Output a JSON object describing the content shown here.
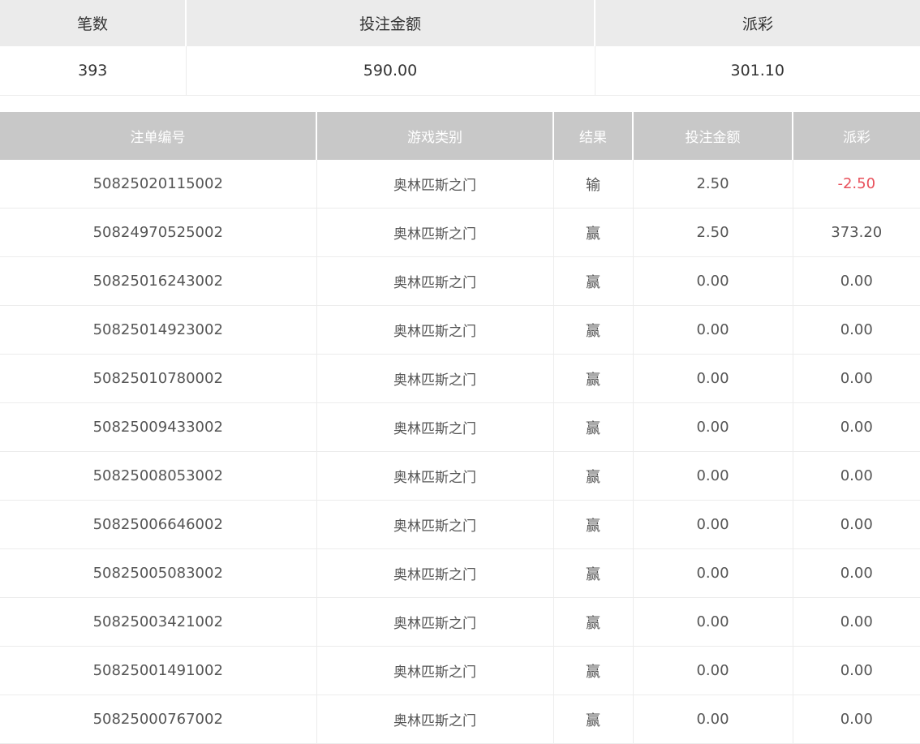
{
  "summary": {
    "headers": [
      "笔数",
      "投注金额",
      "派彩"
    ],
    "values": [
      "393",
      "590.00",
      "301.10"
    ]
  },
  "orders": {
    "headers": [
      "注单编号",
      "游戏类别",
      "结果",
      "投注金额",
      "派彩"
    ],
    "rows": [
      {
        "id": "50825020115002",
        "game": "奥林匹斯之门",
        "result": "输",
        "bet": "2.50",
        "payout": "-2.50"
      },
      {
        "id": "50824970525002",
        "game": "奥林匹斯之门",
        "result": "赢",
        "bet": "2.50",
        "payout": "373.20"
      },
      {
        "id": "50825016243002",
        "game": "奥林匹斯之门",
        "result": "赢",
        "bet": "0.00",
        "payout": "0.00"
      },
      {
        "id": "50825014923002",
        "game": "奥林匹斯之门",
        "result": "赢",
        "bet": "0.00",
        "payout": "0.00"
      },
      {
        "id": "50825010780002",
        "game": "奥林匹斯之门",
        "result": "赢",
        "bet": "0.00",
        "payout": "0.00"
      },
      {
        "id": "50825009433002",
        "game": "奥林匹斯之门",
        "result": "赢",
        "bet": "0.00",
        "payout": "0.00"
      },
      {
        "id": "50825008053002",
        "game": "奥林匹斯之门",
        "result": "赢",
        "bet": "0.00",
        "payout": "0.00"
      },
      {
        "id": "50825006646002",
        "game": "奥林匹斯之门",
        "result": "赢",
        "bet": "0.00",
        "payout": "0.00"
      },
      {
        "id": "50825005083002",
        "game": "奥林匹斯之门",
        "result": "赢",
        "bet": "0.00",
        "payout": "0.00"
      },
      {
        "id": "50825003421002",
        "game": "奥林匹斯之门",
        "result": "赢",
        "bet": "0.00",
        "payout": "0.00"
      },
      {
        "id": "50825001491002",
        "game": "奥林匹斯之门",
        "result": "赢",
        "bet": "0.00",
        "payout": "0.00"
      },
      {
        "id": "50825000767002",
        "game": "奥林匹斯之门",
        "result": "赢",
        "bet": "0.00",
        "payout": "0.00"
      }
    ]
  },
  "colors": {
    "header_bg": "#c8c8c8",
    "summary_header_bg": "#ebebeb",
    "negative_payout": "#e8505b"
  }
}
